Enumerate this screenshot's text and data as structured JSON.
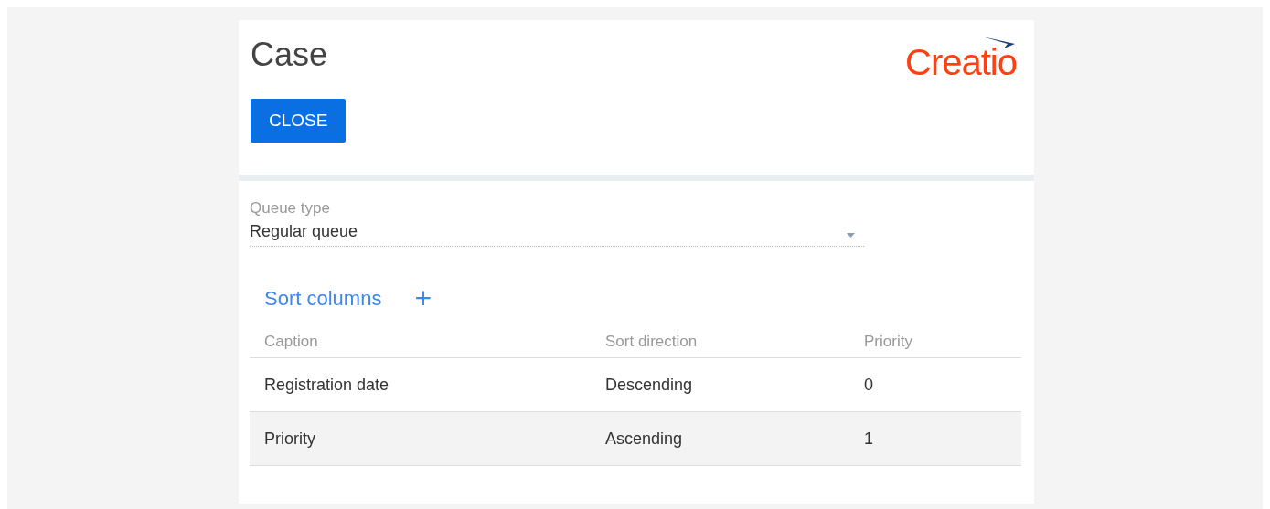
{
  "page": {
    "title": "Case",
    "logo": "Creatio",
    "close_button": "CLOSE"
  },
  "queue_type": {
    "label": "Queue type",
    "value": "Regular queue"
  },
  "sort_columns": {
    "title": "Sort columns",
    "add": "+",
    "columns": [
      "Caption",
      "Sort direction",
      "Priority"
    ],
    "rows": [
      {
        "cells": [
          "Registration date",
          "Descending",
          "0"
        ],
        "selected": false
      },
      {
        "cells": [
          "Priority",
          "Ascending",
          "1"
        ],
        "selected": true
      }
    ]
  }
}
